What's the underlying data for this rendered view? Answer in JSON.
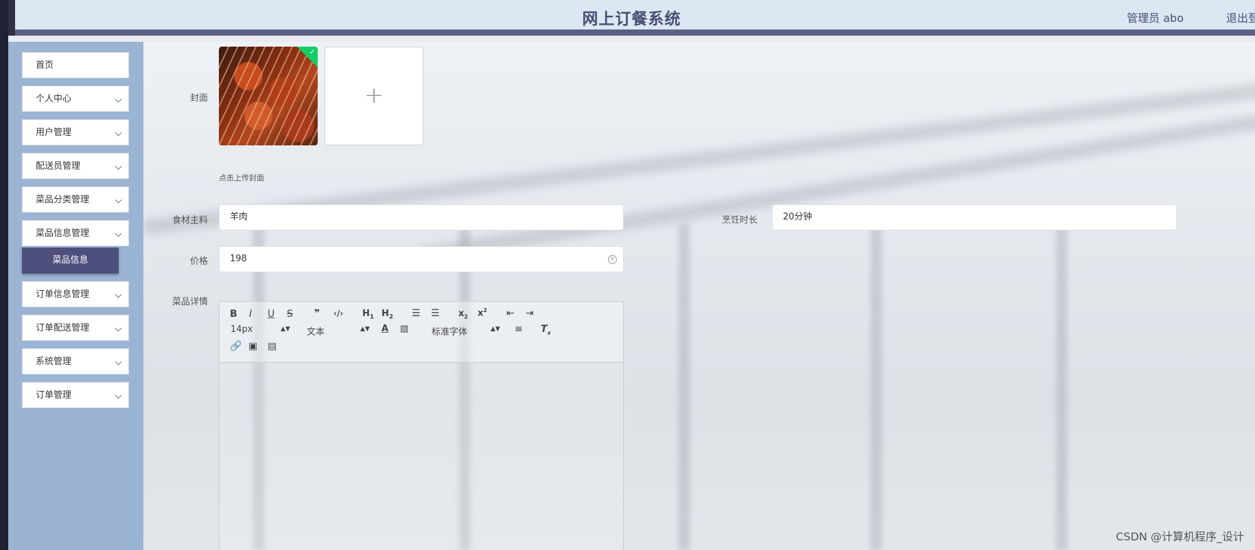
{
  "header": {
    "title": "网上订餐系统",
    "user": "管理员 abo",
    "logout": "退出登"
  },
  "sidebar": {
    "items": [
      {
        "label": "首页",
        "chevron": false
      },
      {
        "label": "个人中心",
        "chevron": true
      },
      {
        "label": "用户管理",
        "chevron": true
      },
      {
        "label": "配送员管理",
        "chevron": true
      },
      {
        "label": "菜品分类管理",
        "chevron": true
      },
      {
        "label": "菜品信息管理",
        "chevron": true
      },
      {
        "label": "订单信息管理",
        "chevron": true
      },
      {
        "label": "订单配送管理",
        "chevron": true
      },
      {
        "label": "系统管理",
        "chevron": true
      },
      {
        "label": "订单管理",
        "chevron": true
      }
    ],
    "submenu": {
      "label": "菜品信息"
    }
  },
  "form": {
    "cover_label": "封面",
    "upload_hint": "点击上传封面",
    "ingredient_label": "食材主料",
    "ingredient_value": "羊肉",
    "cook_time_label": "烹饪时长",
    "cook_time_value": "20分钟",
    "price_label": "价格",
    "price_value": "198",
    "detail_label": "菜品详情"
  },
  "editor": {
    "font_size": "14px",
    "paragraph": "文本",
    "font_family": "标准字体"
  },
  "icons": {
    "plus": "+",
    "check": "✓",
    "clear": "×"
  },
  "watermark": "CSDN @计算机程序_设计",
  "colors": {
    "header_text": "#4a4d72",
    "sidebar_bg": "#9cb4d3",
    "submenu_active": "#4e4f7c",
    "success": "#13ce66"
  }
}
